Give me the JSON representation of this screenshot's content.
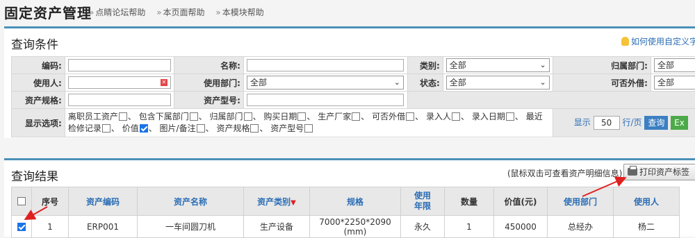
{
  "header": {
    "title": "固定资产管理",
    "breadcrumbs": [
      "点睛论坛帮助",
      "本页面帮助",
      "本模块帮助"
    ]
  },
  "query": {
    "title": "查询条件",
    "help_link": "如何使用自定义字",
    "labels": {
      "code": "编码:",
      "name": "名称:",
      "category": "类别:",
      "dept": "归属部门:",
      "user": "使用人:",
      "use_dept": "使用部门:",
      "status": "状态:",
      "lendable": "可否外借:",
      "spec": "资产规格:",
      "model": "资产型号:",
      "options": "显示选项:"
    },
    "values": {
      "category": "全部",
      "dept": "全部",
      "use_dept": "全部",
      "status": "全部",
      "lendable": "全部"
    },
    "options": [
      {
        "label": "离职员工资产",
        "checked": false,
        "suffix": "、"
      },
      {
        "label": "包含下属部门",
        "checked": false,
        "suffix": "、"
      },
      {
        "label": "归属部门",
        "checked": false,
        "suffix": "、"
      },
      {
        "label": "购买日期",
        "checked": false,
        "suffix": "、"
      },
      {
        "label": "生产厂家",
        "checked": false,
        "suffix": "、"
      },
      {
        "label": "可否外借",
        "checked": false,
        "suffix": "、"
      },
      {
        "label": "录入人",
        "checked": false,
        "suffix": "、"
      },
      {
        "label": "录入日期",
        "checked": false,
        "suffix": "、"
      },
      {
        "label": "最近检修记录",
        "checked": false,
        "suffix": "、"
      },
      {
        "label": "价值",
        "checked": true,
        "suffix": "、"
      },
      {
        "label": "图片/备注",
        "checked": false,
        "suffix": "、"
      },
      {
        "label": "资产规格",
        "checked": false,
        "suffix": "、"
      },
      {
        "label": "资产型号",
        "checked": false,
        "suffix": ""
      }
    ],
    "page_size_prefix": "显示",
    "page_size": "50",
    "page_size_suffix": "行/页",
    "search_button": "查询",
    "export_button": "Ex"
  },
  "results": {
    "title": "查询结果",
    "note": "(鼠标双击可查看资产明细信息)",
    "print_button": "打印资产标签",
    "columns": [
      "序号",
      "资产编码",
      "资产名称",
      "资产类别",
      "规格",
      "使用年限",
      "数量",
      "价值(元)",
      "使用部门",
      "使用人"
    ],
    "sort_marker": "▼",
    "rows": [
      {
        "checked": true,
        "index": "1",
        "code": "ERP001",
        "name": "一车间圆刀机",
        "category": "生产设备",
        "spec": "7000*2250*2090 (mm)",
        "years": "永久",
        "qty": "1",
        "value": "450000",
        "dept": "总经办",
        "user": "杨二"
      }
    ]
  },
  "colors": {
    "panel_border": "#4a90b8",
    "link": "#2a6db5",
    "arrow": "#e02020",
    "search_button": "#3c7fc2",
    "export_button": "#4caa49"
  }
}
